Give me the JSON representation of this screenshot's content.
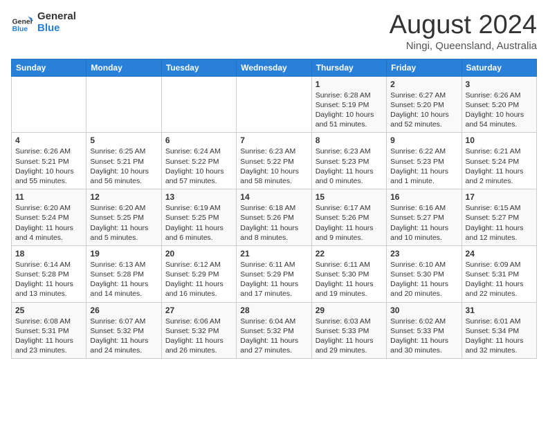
{
  "logo": {
    "line1": "General",
    "line2": "Blue"
  },
  "title": "August 2024",
  "subtitle": "Ningi, Queensland, Australia",
  "weekdays": [
    "Sunday",
    "Monday",
    "Tuesday",
    "Wednesday",
    "Thursday",
    "Friday",
    "Saturday"
  ],
  "weeks": [
    [
      null,
      null,
      null,
      null,
      {
        "day": "1",
        "sunrise": "6:28 AM",
        "sunset": "5:19 PM",
        "daylight": "10 hours and 51 minutes."
      },
      {
        "day": "2",
        "sunrise": "6:27 AM",
        "sunset": "5:20 PM",
        "daylight": "10 hours and 52 minutes."
      },
      {
        "day": "3",
        "sunrise": "6:26 AM",
        "sunset": "5:20 PM",
        "daylight": "10 hours and 54 minutes."
      }
    ],
    [
      {
        "day": "4",
        "sunrise": "6:26 AM",
        "sunset": "5:21 PM",
        "daylight": "10 hours and 55 minutes."
      },
      {
        "day": "5",
        "sunrise": "6:25 AM",
        "sunset": "5:21 PM",
        "daylight": "10 hours and 56 minutes."
      },
      {
        "day": "6",
        "sunrise": "6:24 AM",
        "sunset": "5:22 PM",
        "daylight": "10 hours and 57 minutes."
      },
      {
        "day": "7",
        "sunrise": "6:23 AM",
        "sunset": "5:22 PM",
        "daylight": "10 hours and 58 minutes."
      },
      {
        "day": "8",
        "sunrise": "6:23 AM",
        "sunset": "5:23 PM",
        "daylight": "11 hours and 0 minutes."
      },
      {
        "day": "9",
        "sunrise": "6:22 AM",
        "sunset": "5:23 PM",
        "daylight": "11 hours and 1 minute."
      },
      {
        "day": "10",
        "sunrise": "6:21 AM",
        "sunset": "5:24 PM",
        "daylight": "11 hours and 2 minutes."
      }
    ],
    [
      {
        "day": "11",
        "sunrise": "6:20 AM",
        "sunset": "5:24 PM",
        "daylight": "11 hours and 4 minutes."
      },
      {
        "day": "12",
        "sunrise": "6:20 AM",
        "sunset": "5:25 PM",
        "daylight": "11 hours and 5 minutes."
      },
      {
        "day": "13",
        "sunrise": "6:19 AM",
        "sunset": "5:25 PM",
        "daylight": "11 hours and 6 minutes."
      },
      {
        "day": "14",
        "sunrise": "6:18 AM",
        "sunset": "5:26 PM",
        "daylight": "11 hours and 8 minutes."
      },
      {
        "day": "15",
        "sunrise": "6:17 AM",
        "sunset": "5:26 PM",
        "daylight": "11 hours and 9 minutes."
      },
      {
        "day": "16",
        "sunrise": "6:16 AM",
        "sunset": "5:27 PM",
        "daylight": "11 hours and 10 minutes."
      },
      {
        "day": "17",
        "sunrise": "6:15 AM",
        "sunset": "5:27 PM",
        "daylight": "11 hours and 12 minutes."
      }
    ],
    [
      {
        "day": "18",
        "sunrise": "6:14 AM",
        "sunset": "5:28 PM",
        "daylight": "11 hours and 13 minutes."
      },
      {
        "day": "19",
        "sunrise": "6:13 AM",
        "sunset": "5:28 PM",
        "daylight": "11 hours and 14 minutes."
      },
      {
        "day": "20",
        "sunrise": "6:12 AM",
        "sunset": "5:29 PM",
        "daylight": "11 hours and 16 minutes."
      },
      {
        "day": "21",
        "sunrise": "6:11 AM",
        "sunset": "5:29 PM",
        "daylight": "11 hours and 17 minutes."
      },
      {
        "day": "22",
        "sunrise": "6:11 AM",
        "sunset": "5:30 PM",
        "daylight": "11 hours and 19 minutes."
      },
      {
        "day": "23",
        "sunrise": "6:10 AM",
        "sunset": "5:30 PM",
        "daylight": "11 hours and 20 minutes."
      },
      {
        "day": "24",
        "sunrise": "6:09 AM",
        "sunset": "5:31 PM",
        "daylight": "11 hours and 22 minutes."
      }
    ],
    [
      {
        "day": "25",
        "sunrise": "6:08 AM",
        "sunset": "5:31 PM",
        "daylight": "11 hours and 23 minutes."
      },
      {
        "day": "26",
        "sunrise": "6:07 AM",
        "sunset": "5:32 PM",
        "daylight": "11 hours and 24 minutes."
      },
      {
        "day": "27",
        "sunrise": "6:06 AM",
        "sunset": "5:32 PM",
        "daylight": "11 hours and 26 minutes."
      },
      {
        "day": "28",
        "sunrise": "6:04 AM",
        "sunset": "5:32 PM",
        "daylight": "11 hours and 27 minutes."
      },
      {
        "day": "29",
        "sunrise": "6:03 AM",
        "sunset": "5:33 PM",
        "daylight": "11 hours and 29 minutes."
      },
      {
        "day": "30",
        "sunrise": "6:02 AM",
        "sunset": "5:33 PM",
        "daylight": "11 hours and 30 minutes."
      },
      {
        "day": "31",
        "sunrise": "6:01 AM",
        "sunset": "5:34 PM",
        "daylight": "11 hours and 32 minutes."
      }
    ]
  ]
}
